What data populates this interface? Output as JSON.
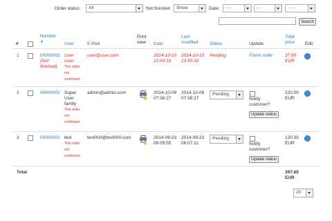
{
  "filters": {
    "order_status_label": "Order status:",
    "order_status_value": "All",
    "not_finished_label": "Not finished:",
    "not_finished_value": "Show",
    "date_label": "Date:",
    "date_day": "- - -",
    "date_month": "- -",
    "date_year": "- - -",
    "search_button": "Search"
  },
  "columns": {
    "num": "#",
    "number": "Number",
    "sort_arrow": "▼",
    "user": "User",
    "email": "E-Mail",
    "print": "Print view",
    "date": "Date",
    "last_modified": "Last modified",
    "status": "Status",
    "update": "Update",
    "total_price": "Total price",
    "edit": "Edit"
  },
  "rows": [
    {
      "idx": "1",
      "number": "00000003",
      "number_note": "(Not finished)",
      "user": "User User",
      "user_note": "This order not confirmed.",
      "email": "user@user.com",
      "date": "2014-10-10 13:55:10",
      "modified": "2014-10-10 13:55:10",
      "status": "Pending",
      "update": "Finish order",
      "price": "37.60 EUR"
    },
    {
      "idx": "2",
      "number": "00000002",
      "user": "Super User family",
      "user_note": "This order not confirmed.",
      "email": "admin@admin.com",
      "date": "2014-10-09 07:38:27",
      "modified": "2014-10-09 07:38:27",
      "status": "Pending",
      "notify": "Notify customer?",
      "update_btn": "Update status",
      "price": "220.00 EUR"
    },
    {
      "idx": "3",
      "number": "00000001",
      "user": "test",
      "user_note": "This order not confirmed.",
      "email": "test000@test000.com",
      "date": "2014-09-23 06:05:55",
      "modified": "2014-09-23 06:07:11",
      "status": "Pending",
      "notify": "Notify customer?",
      "update_btn": "Update status",
      "price": "120.00 EUR"
    }
  ],
  "footer": {
    "total_label": "Total",
    "total_value": "397.60 EUR",
    "page_size": "20"
  }
}
